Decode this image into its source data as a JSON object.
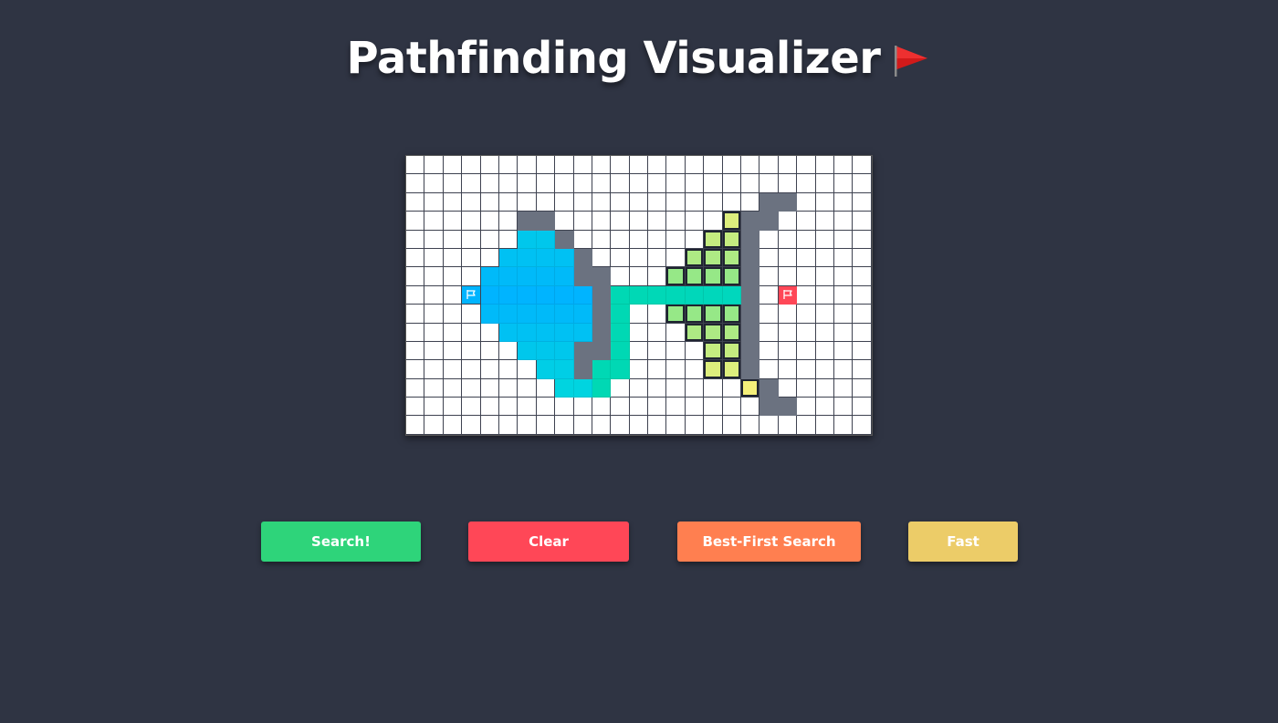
{
  "title": "Pathfinding Visualizer",
  "title_icon": "red-flag-icon",
  "colors": {
    "background": "#2f3443",
    "wall": "#6b7280",
    "end": "#ff4757",
    "search": "#2ed47a",
    "clear": "#ff4757",
    "algorithm": "#ff7f50",
    "speed": "#eccc68"
  },
  "buttons": {
    "search_label": "Search!",
    "clear_label": "Clear",
    "algorithm_label": "Best-First Search",
    "speed_label": "Fast"
  },
  "grid": {
    "cols": 25,
    "rows": 15,
    "start": [
      7,
      3
    ],
    "end": [
      7,
      20
    ],
    "walls": [
      [
        2,
        19
      ],
      [
        2,
        20
      ],
      [
        3,
        6
      ],
      [
        3,
        7
      ],
      [
        3,
        18
      ],
      [
        3,
        19
      ],
      [
        4,
        8
      ],
      [
        4,
        18
      ],
      [
        5,
        9
      ],
      [
        5,
        18
      ],
      [
        6,
        9
      ],
      [
        6,
        10
      ],
      [
        6,
        18
      ],
      [
        7,
        10
      ],
      [
        7,
        18
      ],
      [
        8,
        10
      ],
      [
        8,
        18
      ],
      [
        9,
        10
      ],
      [
        9,
        18
      ],
      [
        10,
        9
      ],
      [
        10,
        10
      ],
      [
        10,
        18
      ],
      [
        11,
        9
      ],
      [
        11,
        18
      ],
      [
        12,
        19
      ],
      [
        13,
        19
      ],
      [
        13,
        20
      ]
    ],
    "visited": [
      [
        4,
        6
      ],
      [
        4,
        7
      ],
      [
        5,
        5
      ],
      [
        5,
        6
      ],
      [
        5,
        7
      ],
      [
        5,
        8
      ],
      [
        6,
        4
      ],
      [
        6,
        5
      ],
      [
        6,
        6
      ],
      [
        6,
        7
      ],
      [
        6,
        8
      ],
      [
        7,
        3
      ],
      [
        7,
        4
      ],
      [
        7,
        5
      ],
      [
        7,
        6
      ],
      [
        7,
        7
      ],
      [
        7,
        8
      ],
      [
        7,
        9
      ],
      [
        7,
        11
      ],
      [
        7,
        12
      ],
      [
        7,
        13
      ],
      [
        7,
        14
      ],
      [
        7,
        15
      ],
      [
        7,
        16
      ],
      [
        7,
        17
      ],
      [
        8,
        4
      ],
      [
        8,
        5
      ],
      [
        8,
        6
      ],
      [
        8,
        7
      ],
      [
        8,
        8
      ],
      [
        8,
        9
      ],
      [
        8,
        11
      ],
      [
        9,
        5
      ],
      [
        9,
        6
      ],
      [
        9,
        7
      ],
      [
        9,
        8
      ],
      [
        9,
        9
      ],
      [
        9,
        11
      ],
      [
        10,
        6
      ],
      [
        10,
        7
      ],
      [
        10,
        8
      ],
      [
        10,
        11
      ],
      [
        11,
        7
      ],
      [
        11,
        8
      ],
      [
        11,
        10
      ],
      [
        11,
        11
      ],
      [
        12,
        8
      ],
      [
        12,
        9
      ],
      [
        12,
        10
      ]
    ],
    "frontier": [
      [
        3,
        17
      ],
      [
        4,
        16
      ],
      [
        4,
        17
      ],
      [
        5,
        15
      ],
      [
        5,
        16
      ],
      [
        5,
        17
      ],
      [
        6,
        14
      ],
      [
        6,
        15
      ],
      [
        6,
        16
      ],
      [
        6,
        17
      ],
      [
        8,
        14
      ],
      [
        8,
        15
      ],
      [
        8,
        16
      ],
      [
        8,
        17
      ],
      [
        9,
        15
      ],
      [
        9,
        16
      ],
      [
        9,
        17
      ],
      [
        10,
        16
      ],
      [
        10,
        17
      ],
      [
        11,
        16
      ],
      [
        11,
        17
      ],
      [
        11,
        18
      ],
      [
        12,
        18
      ]
    ],
    "gradient": {
      "blue": "#00b4ff",
      "cyan": "#00d4e0",
      "teal": "#00d8b4",
      "green": "#7ee68a",
      "yellow": "#f5f07a"
    }
  }
}
